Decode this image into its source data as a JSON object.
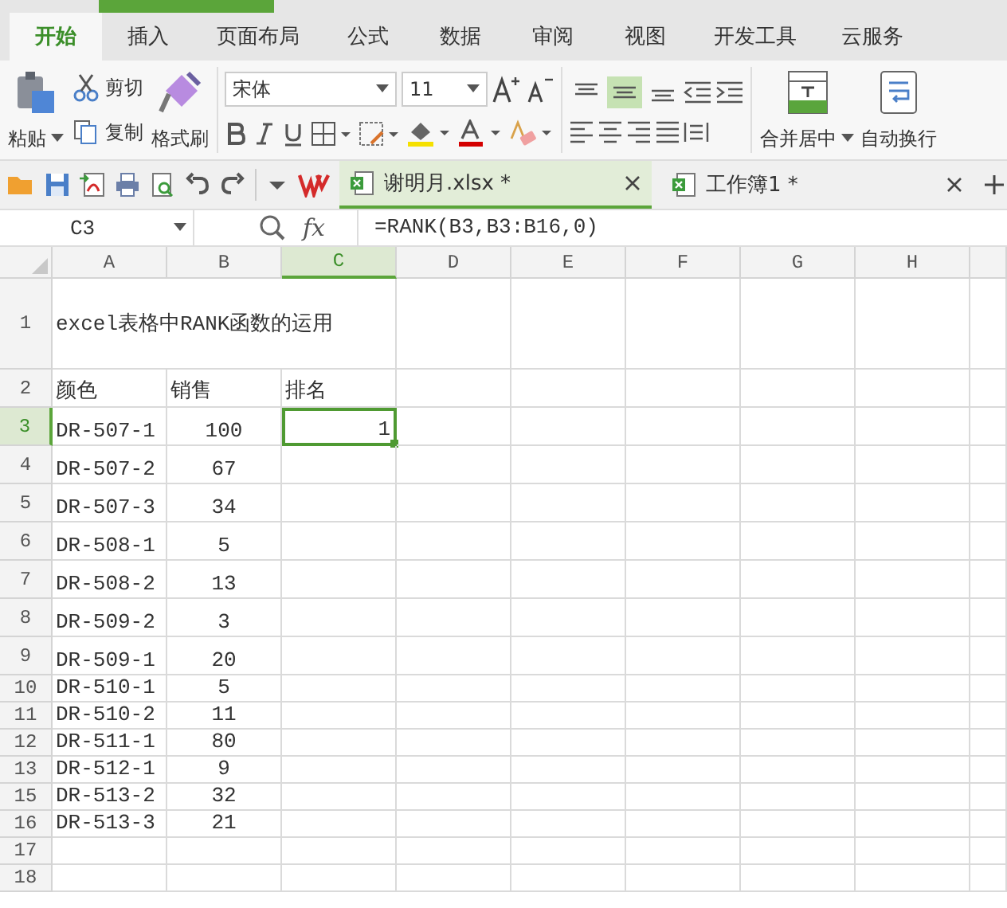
{
  "menu_tabs": [
    {
      "label": "开始",
      "selected": true
    },
    {
      "label": "插入",
      "selected": false
    },
    {
      "label": "页面布局",
      "selected": false
    },
    {
      "label": "公式",
      "selected": false
    },
    {
      "label": "数据",
      "selected": false
    },
    {
      "label": "审阅",
      "selected": false
    },
    {
      "label": "视图",
      "selected": false
    },
    {
      "label": "开发工具",
      "selected": false
    },
    {
      "label": "云服务",
      "selected": false
    }
  ],
  "ribbon": {
    "paste": "粘贴",
    "cut": "剪切",
    "copy": "复制",
    "format_painter": "格式刷",
    "font_name": "宋体",
    "font_size": "11",
    "vertical_align": [
      {
        "selected": false
      },
      {
        "selected": true
      },
      {
        "selected": false
      }
    ],
    "merge": "合并居中",
    "wrap": "自动换行"
  },
  "doc_tabs": [
    {
      "label": "谢明月.xlsx *",
      "selected": true
    },
    {
      "label": "工作簿1 *",
      "selected": false
    }
  ],
  "formula_bar": {
    "name_box": "C3",
    "fx": "fx",
    "formula": "=RANK(B3,B3:B16,0)"
  },
  "sheet": {
    "columns": [
      {
        "label": "A",
        "selected": false
      },
      {
        "label": "B",
        "selected": false
      },
      {
        "label": "C",
        "selected": true
      },
      {
        "label": "D",
        "selected": false
      },
      {
        "label": "E",
        "selected": false
      },
      {
        "label": "F",
        "selected": false
      },
      {
        "label": "G",
        "selected": false
      },
      {
        "label": "H",
        "selected": false
      }
    ],
    "rows": [
      {
        "header": "1",
        "selected": false,
        "title": "excel表格中RANK函数的运用"
      },
      {
        "header": "2",
        "selected": false,
        "a": "颜色",
        "b": "销售",
        "c": "排名",
        "c_selected": false
      },
      {
        "header": "3",
        "selected": true,
        "a": "DR-507-1",
        "b": "100",
        "c": "1",
        "c_selected": true
      },
      {
        "header": "4",
        "selected": false,
        "a": "DR-507-2",
        "b": "67",
        "c_selected": false
      },
      {
        "header": "5",
        "selected": false,
        "a": "DR-507-3",
        "b": "34",
        "c_selected": false
      },
      {
        "header": "6",
        "selected": false,
        "a": "DR-508-1",
        "b": "5",
        "c_selected": false
      },
      {
        "header": "7",
        "selected": false,
        "a": "DR-508-2",
        "b": "13",
        "c_selected": false
      },
      {
        "header": "8",
        "selected": false,
        "a": "DR-509-2",
        "b": "3",
        "c_selected": false
      },
      {
        "header": "9",
        "selected": false,
        "a": "DR-509-1",
        "b": "20",
        "c_selected": false
      },
      {
        "header": "10",
        "selected": false,
        "a": "DR-510-1",
        "b": "5",
        "c_selected": false
      },
      {
        "header": "11",
        "selected": false,
        "a": "DR-510-2",
        "b": "11",
        "c_selected": false
      },
      {
        "header": "12",
        "selected": false,
        "a": "DR-511-1",
        "b": "80",
        "c_selected": false
      },
      {
        "header": "13",
        "selected": false,
        "a": "DR-512-1",
        "b": "9",
        "c_selected": false
      },
      {
        "header": "15",
        "selected": false,
        "a": "DR-513-2",
        "b": "32",
        "c_selected": false
      },
      {
        "header": "16",
        "selected": false,
        "a": "DR-513-3",
        "b": "21",
        "c_selected": false
      },
      {
        "header": "17",
        "selected": false,
        "c_selected": false
      },
      {
        "header": "18",
        "selected": false,
        "c_selected": false
      }
    ]
  }
}
